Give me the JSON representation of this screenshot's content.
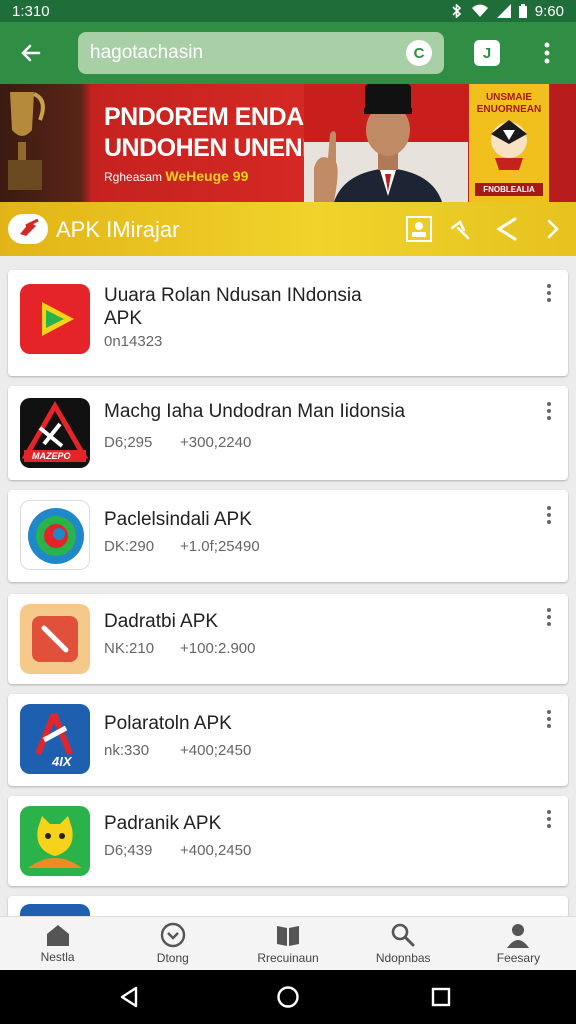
{
  "status": {
    "time": "1:310",
    "battery": "9:60"
  },
  "search": {
    "value": "hagotachasin",
    "clear_label": "C"
  },
  "appbar": {
    "tool_label": "J"
  },
  "banner": {
    "headline": "PNDOREM ENDANAN\nUNDOHEN UNENISIA",
    "subline_prefix": "Rgheasam",
    "subline_highlight": "WeHeuge 99",
    "right_title": "UNSMAIE\nENUORNEAN",
    "right_badge": "FNOBLEALIA"
  },
  "category": {
    "title": "APK IMirajar"
  },
  "apps": [
    {
      "name": "Uuara Rolan Ndusan INdonsia\nAPK",
      "code": "0n14323",
      "count": ""
    },
    {
      "name": "Machg Iaha Undodran Man Iidonsia",
      "code": "D6;295",
      "count": "+300,2240"
    },
    {
      "name": "Paclelsindali APK",
      "code": "DK:290",
      "count": "+1.0f;25490"
    },
    {
      "name": "Dadratbi APK",
      "code": "NK:210",
      "count": "+100:2.900"
    },
    {
      "name": "Polaratoln APK",
      "code": "nk:330",
      "count": "+400;2450"
    },
    {
      "name": "Padranik APK",
      "code": "D6;439",
      "count": "+400,2450"
    }
  ],
  "app_icon_text": {
    "app2": "MAZEPO",
    "app5": "4IX"
  },
  "nav": [
    {
      "label": "Nestla",
      "icon": "home-icon"
    },
    {
      "label": "Dtong",
      "icon": "download-circle-icon"
    },
    {
      "label": "Rrecuinaun",
      "icon": "book-icon"
    },
    {
      "label": "Ndopnbas",
      "icon": "search-icon"
    },
    {
      "label": "Feesary",
      "icon": "person-icon"
    }
  ],
  "colors": {
    "primary": "#2f8d44",
    "category": "#e8c320",
    "banner_red": "#d72a25"
  }
}
